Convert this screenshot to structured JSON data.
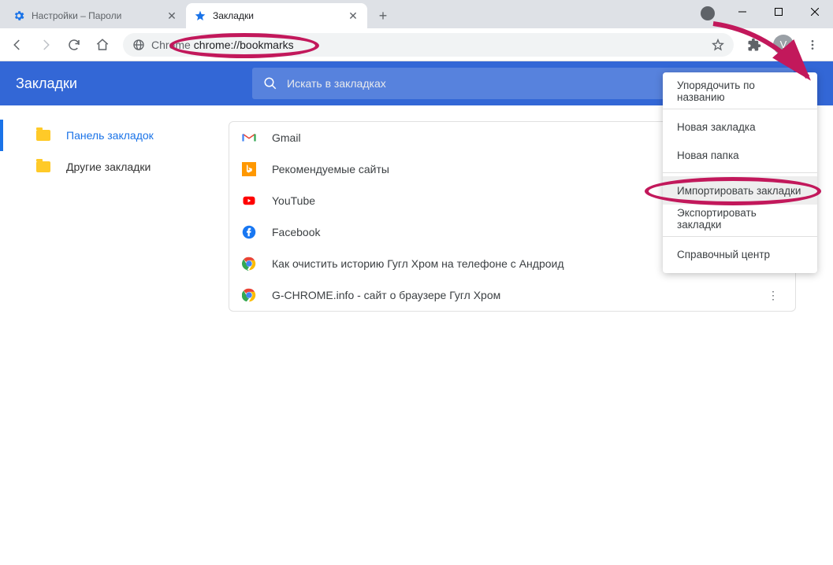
{
  "tabs": [
    {
      "title": "Настройки – Пароли",
      "active": false
    },
    {
      "title": "Закладки",
      "active": true
    }
  ],
  "omnibox": {
    "prefix": "Chrome",
    "url": "chrome://bookmarks"
  },
  "avatar_letter": "V",
  "bm": {
    "title": "Закладки",
    "search_placeholder": "Искать в закладках"
  },
  "sidebar": {
    "items": [
      {
        "label": "Панель закладок",
        "active": true
      },
      {
        "label": "Другие закладки",
        "active": false
      }
    ]
  },
  "bookmarks": [
    {
      "title": "Gmail",
      "icon": "gmail"
    },
    {
      "title": "Рекомендуемые сайты",
      "icon": "bing"
    },
    {
      "title": "YouTube",
      "icon": "youtube"
    },
    {
      "title": "Facebook",
      "icon": "facebook"
    },
    {
      "title": "Как очистить историю Гугл Хром на телефоне с Андроид",
      "icon": "chrome"
    },
    {
      "title": "G-CHROME.info - сайт о браузере Гугл Хром",
      "icon": "chrome"
    }
  ],
  "menu": {
    "sort": "Упорядочить по названию",
    "new_bm": "Новая закладка",
    "new_folder": "Новая папка",
    "import": "Импортировать закладки",
    "export": "Экспортировать закладки",
    "help": "Справочный центр"
  }
}
